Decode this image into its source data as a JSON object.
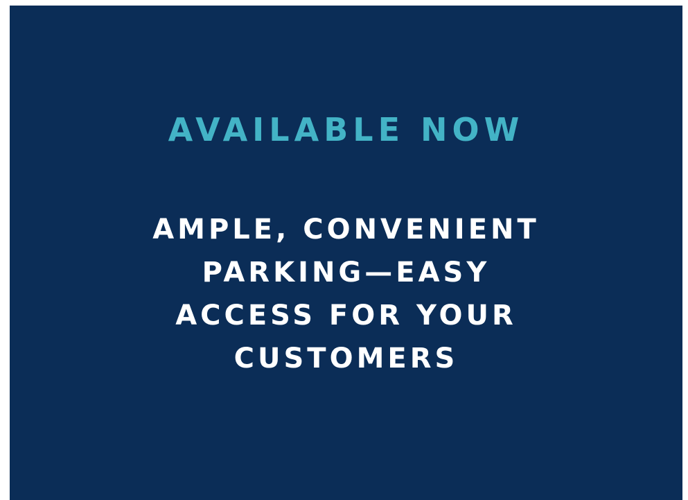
{
  "headline": "AVAILABLE NOW",
  "body_lines": [
    "AMPLE, CONVENIENT",
    "PARKING—EASY",
    "ACCESS FOR YOUR",
    "CUSTOMERS"
  ],
  "colors": {
    "background": "#0b2d57",
    "headline": "#43b3c6",
    "body": "#ffffff",
    "page": "#ffffff"
  }
}
